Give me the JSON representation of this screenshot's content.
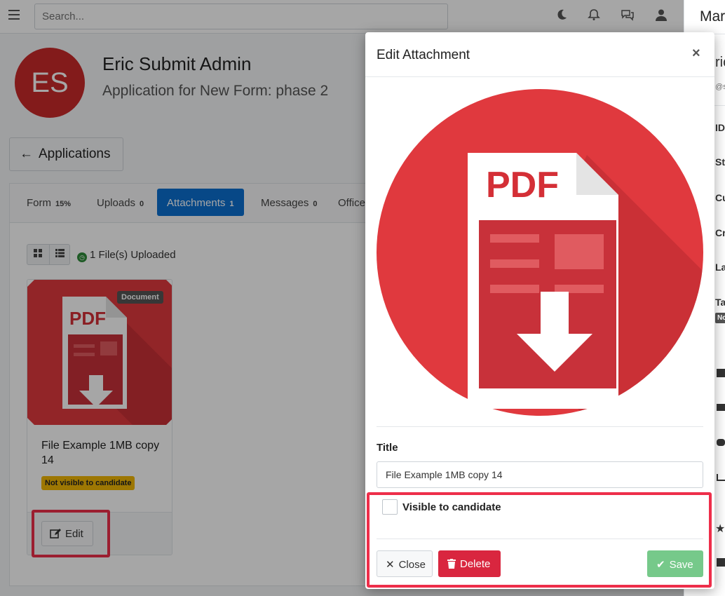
{
  "topbar": {
    "search_placeholder": "Search...",
    "icons": [
      "menu-icon",
      "moon-icon",
      "bell-icon",
      "chat-icon",
      "user-icon"
    ]
  },
  "right_panel": {
    "title_partial": "Mar",
    "labels": [
      "ric",
      "@s",
      "ID",
      "St",
      "Cu",
      "Cr",
      "La",
      "Ta",
      "No"
    ]
  },
  "profile": {
    "initials": "ES",
    "name": "Eric Submit Admin",
    "subtitle": "Application for New Form: phase 2"
  },
  "back_button": {
    "label": "Applications"
  },
  "tabs": [
    {
      "label": "Form",
      "count": "15%",
      "active": false
    },
    {
      "label": "Uploads",
      "count": "0",
      "active": false
    },
    {
      "label": "Attachments",
      "count": "1",
      "active": true
    },
    {
      "label": "Messages",
      "count": "0",
      "active": false
    },
    {
      "label": "Office",
      "count": "",
      "active": false
    }
  ],
  "uploads_status": "1 File(s) Uploaded",
  "file_card": {
    "badge": "Document",
    "name": "File Example 1MB copy 14",
    "visibility": "Not visible to candidate",
    "edit_label": "Edit",
    "thumb_text": "PDF"
  },
  "modal": {
    "title": "Edit Attachment",
    "close_glyph": "×",
    "preview_text": "PDF",
    "title_label": "Title",
    "title_value": "File Example 1MB copy 14",
    "checkbox_label": "Visible to candidate",
    "checkbox_checked": false,
    "close_label": "Close",
    "delete_label": "Delete",
    "save_label": "Save"
  },
  "colors": {
    "accent": "#0b6fd0",
    "pdf_red": "#e0393e",
    "delete": "#d9263f",
    "save": "#76c98a",
    "highlight": "#ee2e4a",
    "badge_yellow": "#f2b705"
  }
}
